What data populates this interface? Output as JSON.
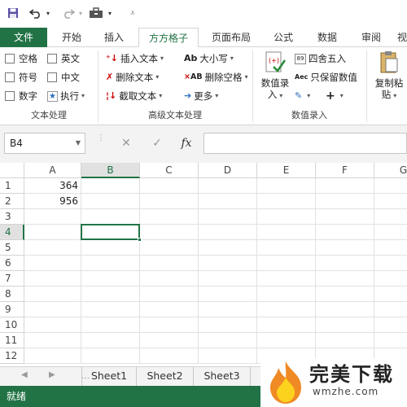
{
  "quick_access": {
    "save_icon": "save-icon",
    "undo_icon": "undo-icon",
    "redo_icon": "redo-icon",
    "toolbar_icon": "briefcase-icon",
    "customize_icon": "customize-icon"
  },
  "tabs": [
    "文件",
    "开始",
    "插入",
    "方方格子",
    "页面布局",
    "公式",
    "数据",
    "审阅",
    "视"
  ],
  "active_tab": "方方格子",
  "ribbon": {
    "text_processing": {
      "label": "文本处理",
      "checkboxes": [
        "空格",
        "英文",
        "符号",
        "中文",
        "数字"
      ],
      "execute": "执行"
    },
    "advanced_text": {
      "label": "高级文本处理",
      "items": [
        "插入文本",
        "删除文本",
        "截取文本",
        "大小写",
        "删除空格",
        "更多"
      ]
    },
    "number_entry": {
      "label": "数值录入",
      "big_button": [
        "数值录",
        "入"
      ],
      "items": [
        "四舍五入",
        "只保留数值"
      ]
    },
    "paste": {
      "big_button": [
        "复制粘",
        "贴"
      ]
    }
  },
  "formula_bar": {
    "name_box": "B4",
    "fx_label": "fx",
    "formula_value": ""
  },
  "grid": {
    "columns": [
      "A",
      "B",
      "C",
      "D",
      "E",
      "F",
      "G"
    ],
    "selected_column": "B",
    "rows": [
      "1",
      "2",
      "3",
      "4",
      "5",
      "6",
      "7",
      "8",
      "9",
      "10",
      "11",
      "12"
    ],
    "selected_row": "4",
    "cells": {
      "A1": "364",
      "A2": "956"
    }
  },
  "sheets": [
    "Sheet1",
    "Sheet2",
    "Sheet3"
  ],
  "status": "就绪",
  "watermark": {
    "title": "完美下载",
    "subtitle": "wmzhe.com"
  },
  "colors": {
    "accent": "#217346"
  }
}
